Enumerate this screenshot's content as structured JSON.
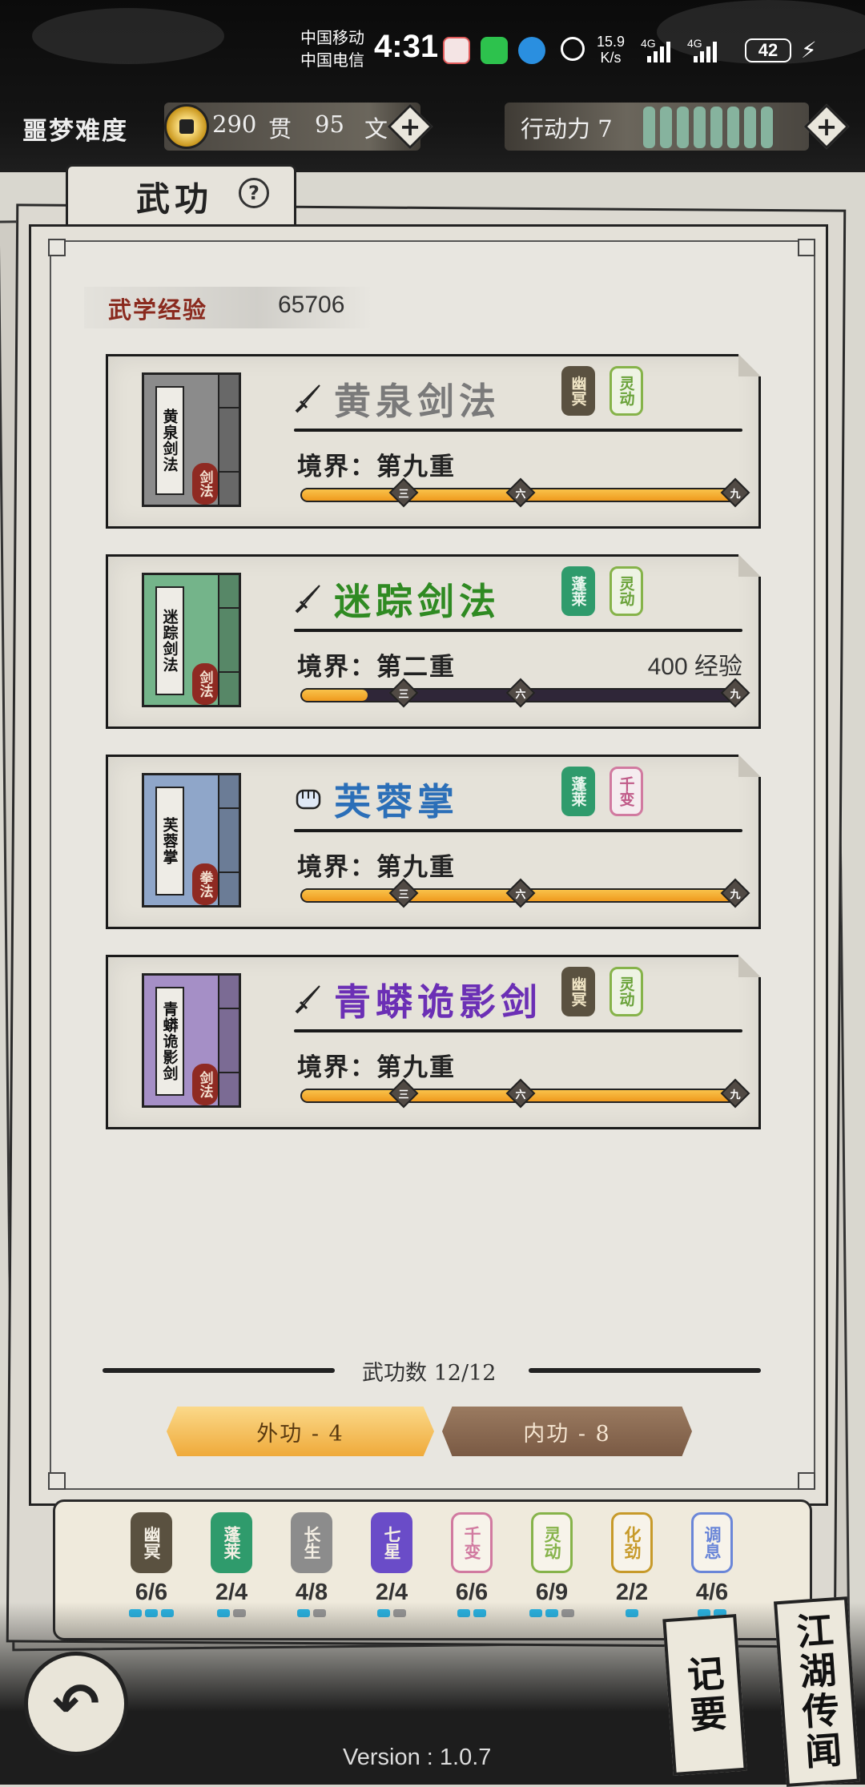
{
  "status_bar": {
    "carrier1": "中国移动",
    "carrier2": "中国电信",
    "time": "4:31",
    "net_speed_value": "15.9",
    "net_speed_unit": "K/s",
    "signal1": "4G",
    "signal2": "4G",
    "battery": "42"
  },
  "resources": {
    "difficulty": "噩梦难度",
    "money_guan": "290",
    "money_guan_unit": "贯",
    "money_wen": "95",
    "money_wen_unit": "文",
    "stamina_label": "行动力 7",
    "stamina_cells": 8
  },
  "page": {
    "tab_title": "武功",
    "help_icon": "?",
    "exp_label": "武学经验",
    "exp_value": "65706"
  },
  "skills": [
    {
      "book_title": "黄泉剑法",
      "book_seal": "剑法",
      "name": "黄泉剑法",
      "name_color": "#7a7a7a",
      "book_color": "#8b8b8b",
      "icon": "sword-icon",
      "tags": [
        "幽冥",
        "灵动"
      ],
      "realm": "境界：第九重",
      "exp_needed": "",
      "progress": 1.0,
      "markers": [
        "三",
        "六",
        "九"
      ]
    },
    {
      "book_title": "迷踪剑法",
      "book_seal": "剑法",
      "name": "迷踪剑法",
      "name_color": "#2f8a22",
      "book_color": "#74b48a",
      "icon": "sword-icon",
      "tags": [
        "蓬莱",
        "灵动"
      ],
      "realm": "境界：第二重",
      "exp_needed": "400 经验",
      "progress": 0.15,
      "markers": [
        "三",
        "六",
        "九"
      ]
    },
    {
      "book_title": "芙蓉掌",
      "book_seal": "拳法",
      "name": "芙蓉掌",
      "name_color": "#2b6fb8",
      "book_color": "#8fa6c9",
      "icon": "fist-icon",
      "tags": [
        "蓬莱",
        "千变"
      ],
      "realm": "境界：第九重",
      "exp_needed": "",
      "progress": 1.0,
      "markers": [
        "三",
        "六",
        "九"
      ]
    },
    {
      "book_title": "青蟒诡影剑",
      "book_seal": "剑法",
      "name": "青蟒诡影剑",
      "name_color": "#6b2fb5",
      "book_color": "#a58fc6",
      "icon": "sword-icon",
      "tags": [
        "幽冥",
        "灵动"
      ],
      "realm": "境界：第九重",
      "exp_needed": "",
      "progress": 1.0,
      "markers": [
        "三",
        "六",
        "九"
      ]
    }
  ],
  "footer": {
    "count": "武功数 12/12",
    "outer_btn": "外功 - 4",
    "inner_btn": "内功 - 8"
  },
  "tag_summary": [
    {
      "name": "幽冥",
      "count": "6/6",
      "color": "#5a5140",
      "dots": [
        1,
        1,
        1
      ]
    },
    {
      "name": "蓬莱",
      "count": "2/4",
      "color": "#2f9b6c",
      "dots": [
        1,
        0
      ]
    },
    {
      "name": "长生",
      "count": "4/8",
      "color": "#8c8c8c",
      "dots": [
        1,
        0
      ]
    },
    {
      "name": "七星",
      "count": "2/4",
      "color": "#6a4cc8",
      "dots": [
        1,
        0
      ]
    },
    {
      "name": "千变",
      "count": "6/6",
      "color": "#d17aa0",
      "dots": [
        1,
        1
      ]
    },
    {
      "name": "灵动",
      "count": "6/9",
      "color": "#86b34a",
      "dots": [
        1,
        1,
        0
      ]
    },
    {
      "name": "化劲",
      "count": "2/2",
      "color": "#c79a2a",
      "dots": [
        1
      ]
    },
    {
      "name": "调息",
      "count": "4/6",
      "color": "#6a86d8",
      "dots": [
        1,
        1
      ]
    }
  ],
  "bottom": {
    "record_label": "记要",
    "rumor_label": "江湖传闻",
    "version": "Version : 1.0.7"
  }
}
